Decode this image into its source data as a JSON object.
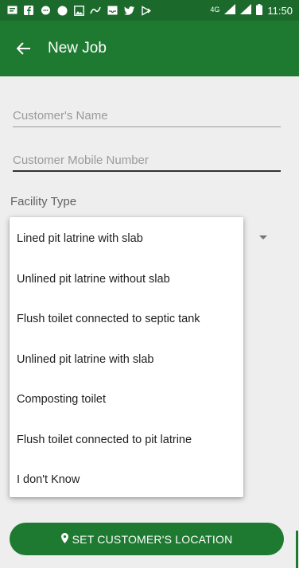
{
  "status_bar": {
    "time": "11:50",
    "network": "4G",
    "icons": [
      "message-icon",
      "facebook-icon",
      "chat-icon",
      "dot-icon",
      "gallery-icon",
      "link-icon",
      "inbox-icon",
      "twitter-icon",
      "play-icon"
    ]
  },
  "app_bar": {
    "title": "New Job",
    "back_icon": "arrow-left-icon"
  },
  "form": {
    "customer_name_placeholder": "Customer's Name",
    "customer_mobile_placeholder": "Customer Mobile Number",
    "facility_label": "Facility Type"
  },
  "facility_options": [
    "Lined pit latrine with slab",
    "Unlined pit latrine without slab",
    "Flush toilet connected to septic tank",
    "Unlined pit latrine with slab",
    "Composting toilet",
    "Flush toilet connected to pit latrine",
    "I don't Know"
  ],
  "location_button": {
    "label": "SET CUSTOMER'S LOCATION",
    "icon": "map-pin-icon"
  },
  "colors": {
    "primary": "#1f7a31",
    "status_bar": "#1b6a2b",
    "background": "#eeeeee"
  }
}
